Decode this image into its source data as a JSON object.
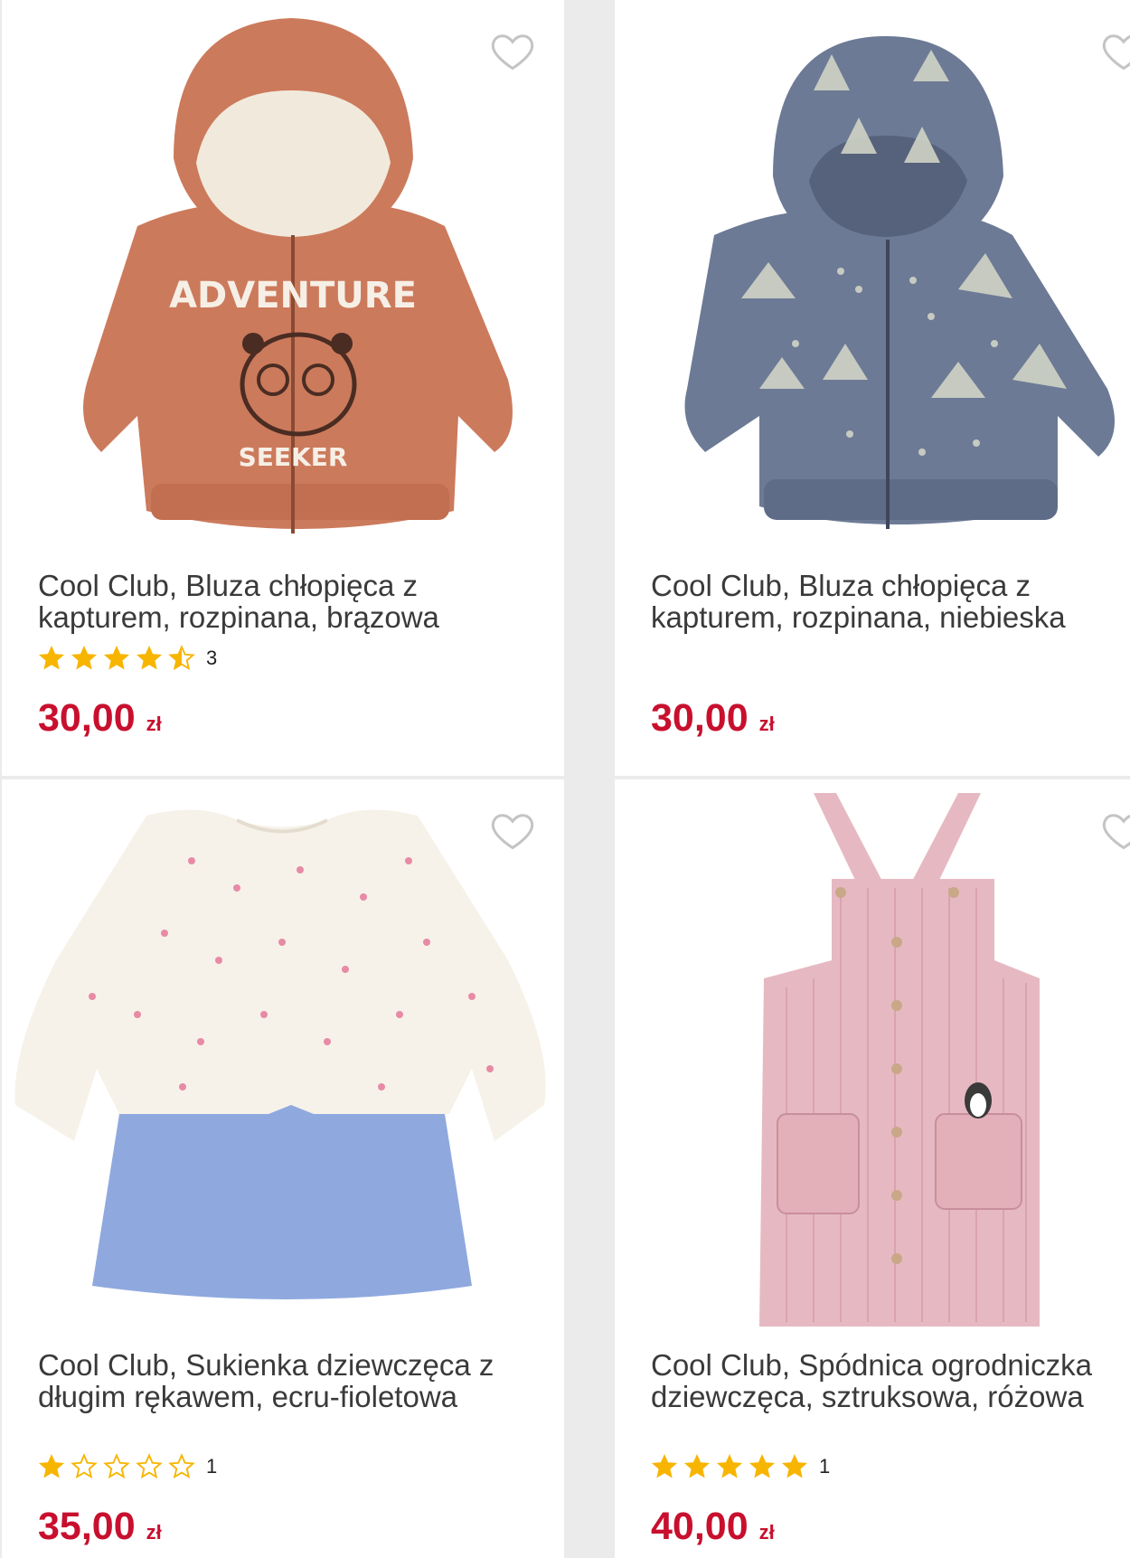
{
  "products": [
    {
      "title": "Cool Club, Bluza chłopięca z kapturem, rozpinana, brązowa",
      "rating": 4.5,
      "rating_count": "3",
      "price": "30,00",
      "currency": "zł",
      "image_icon": "brown-hoodie-image",
      "image_text_top": "ADVENTURE",
      "image_text_bottom": "SEEKER"
    },
    {
      "title": "Cool Club, Bluza chłopięca z kapturem, rozpinana, niebieska",
      "rating": null,
      "rating_count": "",
      "price": "30,00",
      "currency": "zł",
      "image_icon": "blue-patterned-hoodie-image"
    },
    {
      "title": "Cool Club, Sukienka dziewczęca z długim rękawem, ecru-fioletowa",
      "rating": 1,
      "rating_count": "1",
      "price": "35,00",
      "currency": "zł",
      "image_icon": "ecru-blue-dress-image"
    },
    {
      "title": "Cool Club, Spódnica ogrodniczka dziewczęca, sztruksowa, różowa",
      "rating": 5,
      "rating_count": "1",
      "price": "40,00",
      "currency": "zł",
      "image_icon": "pink-pinafore-image"
    }
  ],
  "colors": {
    "price": "#c8102e",
    "star": "#f7b500",
    "heart": "#c4c4c4",
    "background": "#ebebeb"
  }
}
